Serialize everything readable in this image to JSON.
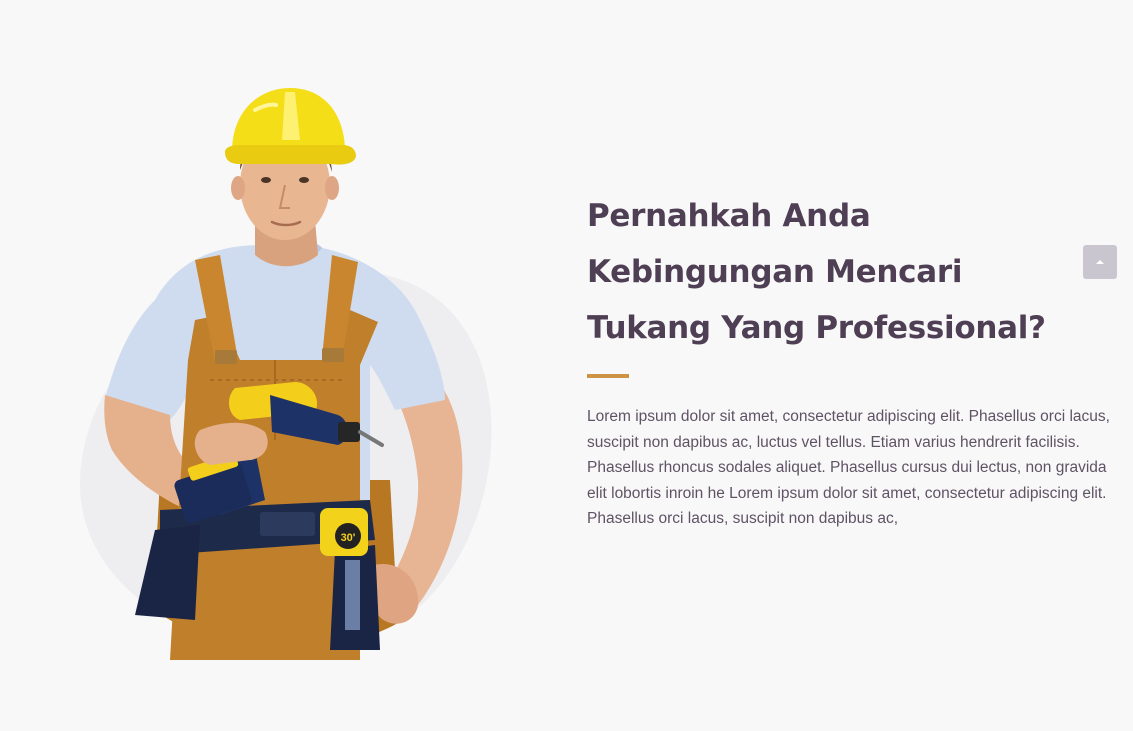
{
  "section": {
    "headline_lines": [
      "Pernahkah Anda",
      "Kebingungan Mencari",
      "Tukang Yang Professional?"
    ],
    "body": "Lorem ipsum dolor sit amet, consectetur adipiscing elit. Phasellus orci lacus, suscipit non dapibus ac, luctus vel tellus. Etiam varius hendrerit facilisis. Phasellus rhoncus sodales aliquet. Phasellus cursus dui lectus, non gravida elit lobortis inroin he Lorem ipsum dolor sit amet, consectetur adipiscing elit. Phasellus orci lacus, suscipit non dapibus ac,",
    "tape_measure_label": "30'"
  },
  "colors": {
    "background": "#f8f8f8",
    "heading": "#4f3f54",
    "body_text": "#5f5265",
    "accent": "#cd9244",
    "scroll_button": "#c9c6d0",
    "blob": "#eeeef0"
  },
  "icons": {
    "scroll_top": "chevron-up-icon"
  }
}
